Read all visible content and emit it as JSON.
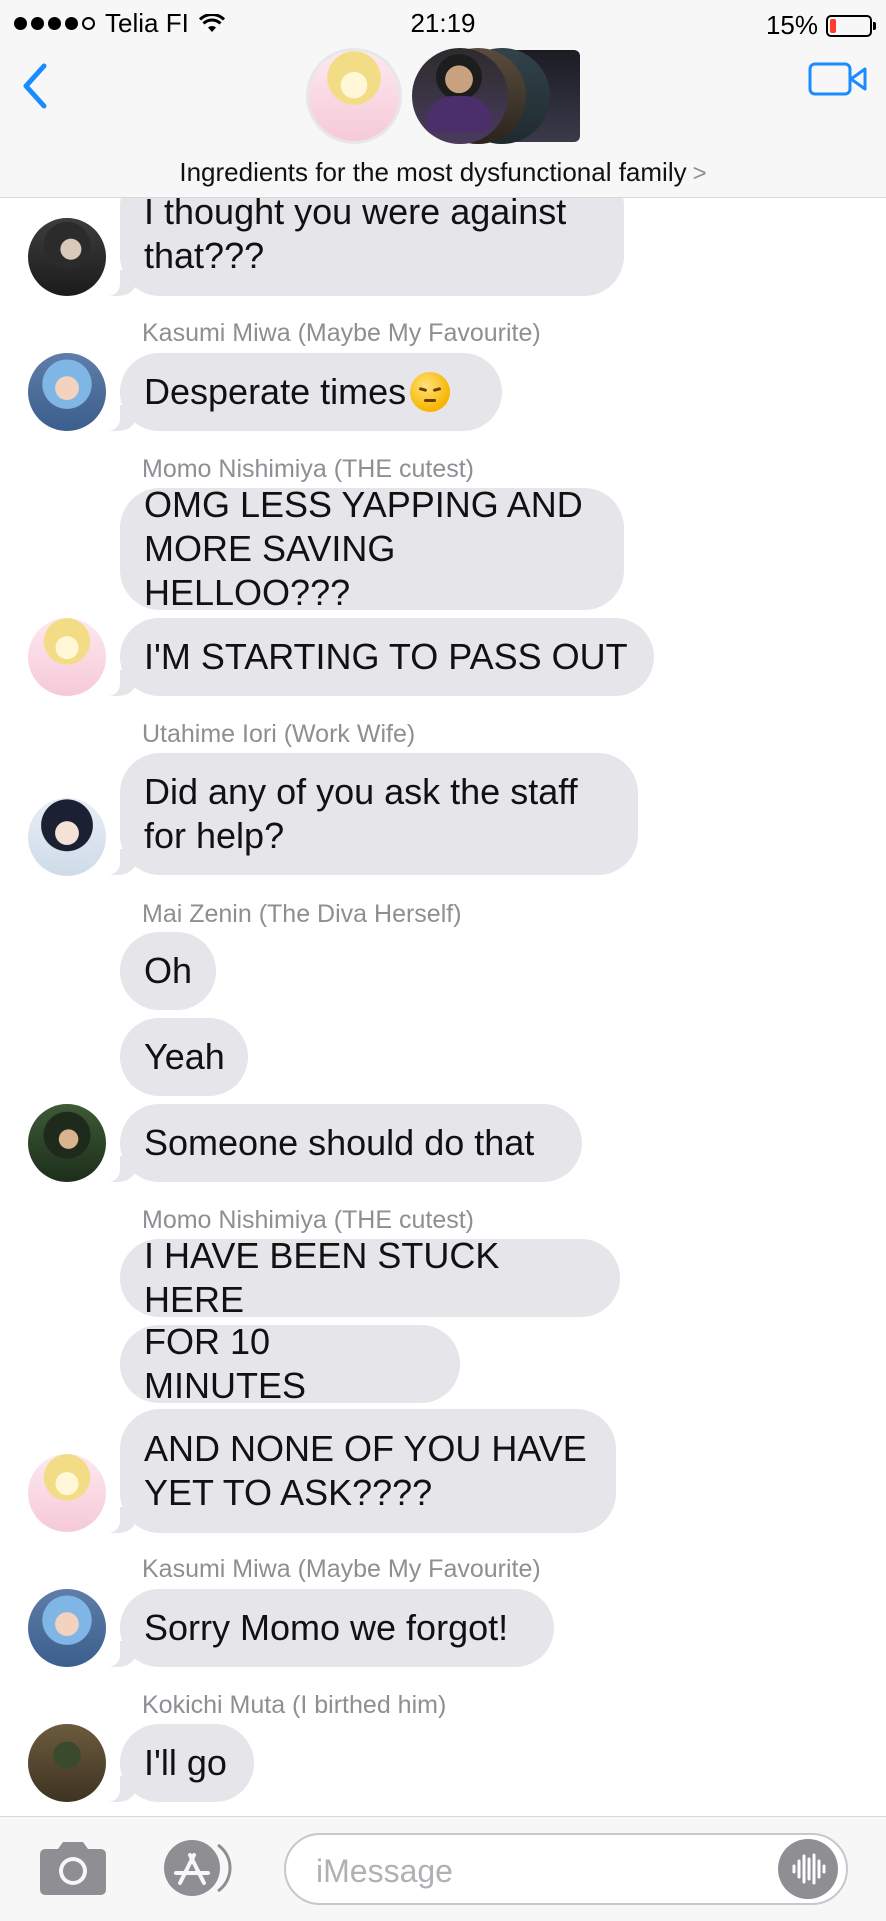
{
  "status_bar": {
    "carrier": "Telia FI",
    "time": "21:19",
    "battery_text": "15%",
    "battery_level": 0.15
  },
  "header": {
    "title": "Ingredients for the most dysfunctional family",
    "chevron": ">"
  },
  "messages": [
    {
      "text": "I thought you were against\nthat???"
    },
    {
      "sender": "Kasumi Miwa (Maybe My Favourite)",
      "text": "Desperate times",
      "emoji": "pensive-face"
    },
    {
      "sender": "Momo Nishimiya (THE cutest)",
      "text": "OMG LESS YAPPING AND\nMORE SAVING HELLOO???"
    },
    {
      "text": "I'M STARTING TO PASS OUT"
    },
    {
      "sender": "Utahime Iori (Work Wife)",
      "text": "Did any of you ask the staff\nfor help?"
    },
    {
      "sender": "Mai Zenin (The Diva Herself)",
      "text": "Oh"
    },
    {
      "text": "Yeah"
    },
    {
      "text": "Someone should do that"
    },
    {
      "sender": "Momo Nishimiya (THE cutest)",
      "text": "I HAVE BEEN STUCK HERE"
    },
    {
      "text": "FOR 10 MINUTES"
    },
    {
      "text": "AND NONE OF YOU HAVE\nYET TO ASK????"
    },
    {
      "sender": "Kasumi Miwa (Maybe My Favourite)",
      "text": "Sorry Momo we forgot!"
    },
    {
      "sender": "Kokichi Muta (I birthed him)",
      "text": "I'll go"
    }
  ],
  "input_bar": {
    "placeholder": "iMessage"
  },
  "colors": {
    "accent": "#1a8cff",
    "bubble": "#e5e5ea",
    "sender_text": "#8e8e93",
    "battery_low": "#ff3b30"
  },
  "icons": [
    "back-chevron-icon",
    "video-camera-icon",
    "camera-icon",
    "app-store-icon",
    "audio-waveform-icon",
    "wifi-icon",
    "battery-icon"
  ]
}
